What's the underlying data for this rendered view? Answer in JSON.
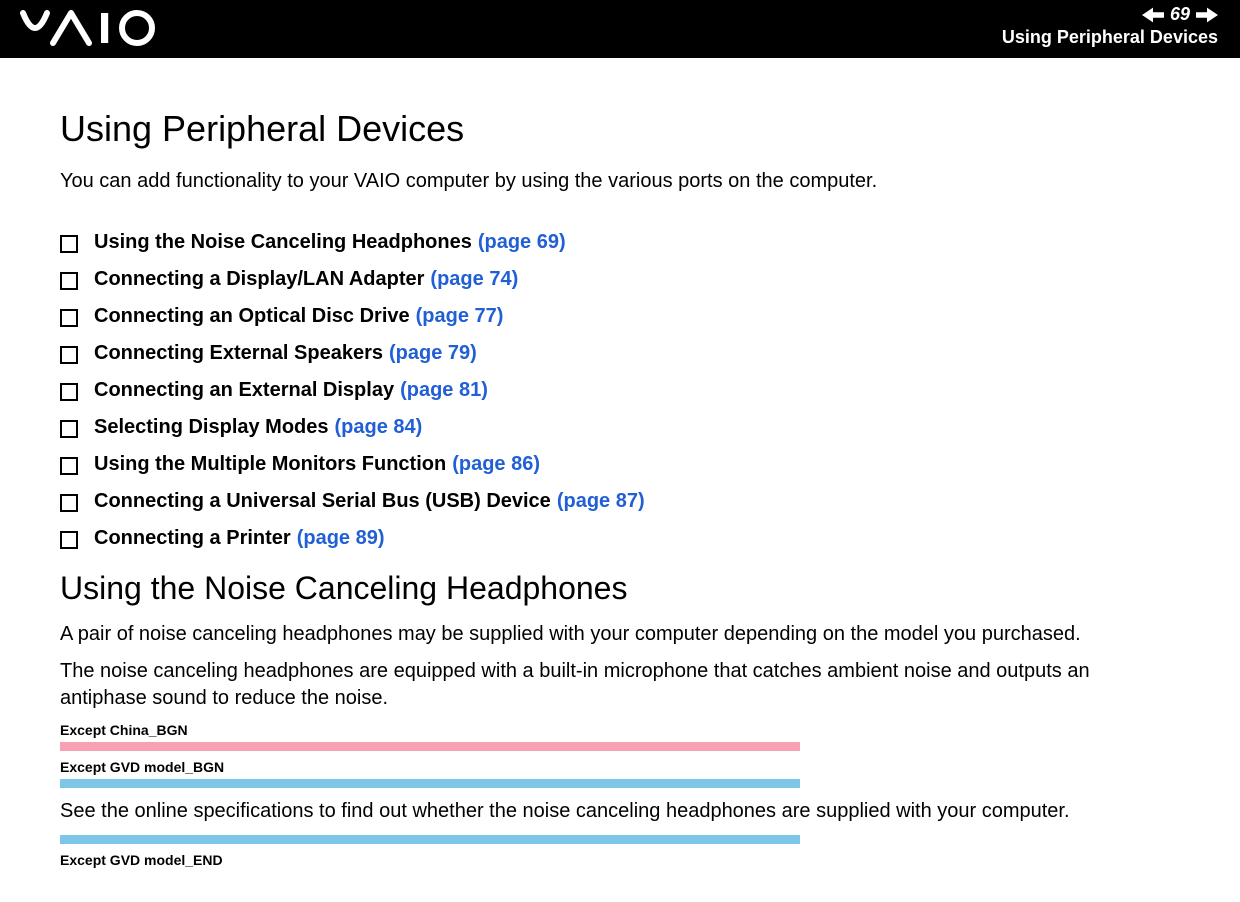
{
  "header": {
    "page_number": "69",
    "section": "Using Peripheral Devices"
  },
  "main": {
    "title": "Using Peripheral Devices",
    "intro": "You can add functionality to your VAIO computer by using the various ports on the computer.",
    "toc": [
      {
        "label": "Using the Noise Canceling Headphones",
        "page": "(page 69)"
      },
      {
        "label": "Connecting a Display/LAN Adapter",
        "page": "(page 74)"
      },
      {
        "label": "Connecting an Optical Disc Drive",
        "page": "(page 77)"
      },
      {
        "label": "Connecting External Speakers",
        "page": "(page 79)"
      },
      {
        "label": "Connecting an External Display",
        "page": "(page 81)"
      },
      {
        "label": "Selecting Display Modes",
        "page": "(page 84)"
      },
      {
        "label": "Using the Multiple Monitors Function",
        "page": "(page 86)"
      },
      {
        "label": "Connecting a Universal Serial Bus (USB) Device",
        "page": "(page 87)"
      },
      {
        "label": "Connecting a Printer",
        "page": "(page 89)"
      }
    ],
    "subsection": {
      "title": "Using the Noise Canceling Headphones",
      "p1": "A pair of noise canceling headphones may be supplied with your computer depending on the model you purchased.",
      "p2": "The noise canceling headphones are equipped with a built-in microphone that catches ambient noise and outputs an antiphase sound to reduce the noise.",
      "note1": "Except China_BGN",
      "note2": "Except GVD model_BGN",
      "p3": "See the online specifications to find out whether the noise canceling headphones are supplied with your computer.",
      "note3": "Except GVD model_END"
    }
  }
}
